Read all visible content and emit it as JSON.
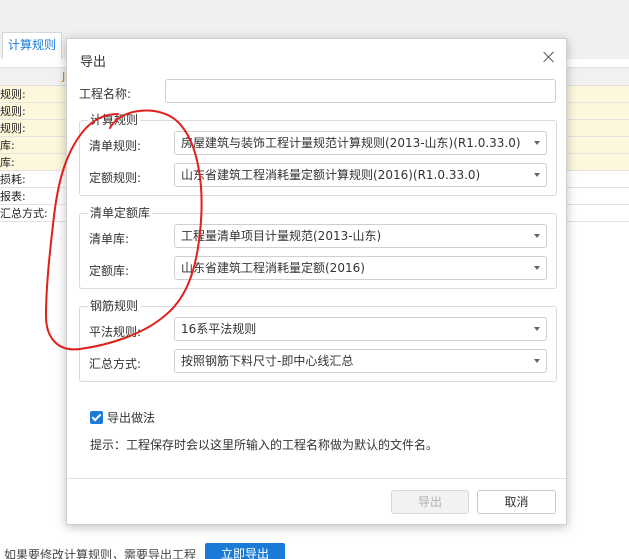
{
  "background": {
    "tab_label": "计算规则",
    "header_mark": "J",
    "rows": [
      "规则:",
      "规则:",
      "规则:",
      "库:",
      "库:",
      "损耗:",
      "报表:",
      "汇总方式:"
    ],
    "bottom_text": "如果要修改计算规则，需要导出工程",
    "bottom_button": "立即导出"
  },
  "dialog": {
    "title": "导出",
    "project_name": {
      "label": "工程名称:",
      "value": "",
      "placeholder": ""
    },
    "groups": [
      {
        "title": "计算规则",
        "rows": [
          {
            "label": "清单规则:",
            "value": "房屋建筑与装饰工程计量规范计算规则(2013-山东)(R1.0.33.0)"
          },
          {
            "label": "定额规则:",
            "value": "山东省建筑工程消耗量定额计算规则(2016)(R1.0.33.0)"
          }
        ]
      },
      {
        "title": "清单定额库",
        "rows": [
          {
            "label": "清单库:",
            "value": "工程量清单项目计量规范(2013-山东)"
          },
          {
            "label": "定额库:",
            "value": "山东省建筑工程消耗量定额(2016)"
          }
        ]
      },
      {
        "title": "钢筋规则",
        "rows": [
          {
            "label": "平法规则:",
            "value": "16系平法规则"
          },
          {
            "label": "汇总方式:",
            "value": "按照钢筋下料尺寸-即中心线汇总"
          }
        ]
      }
    ],
    "export_method": {
      "label": "导出做法",
      "checked": true
    },
    "hint": "提示：工程保存时会以这里所输入的工程名称做为默认的文件名。",
    "buttons": {
      "export": "导出",
      "cancel": "取消"
    }
  },
  "colors": {
    "accent": "#1d7bd8",
    "annotation": "#e0201b",
    "row_highlight": "#fdf7dc"
  }
}
